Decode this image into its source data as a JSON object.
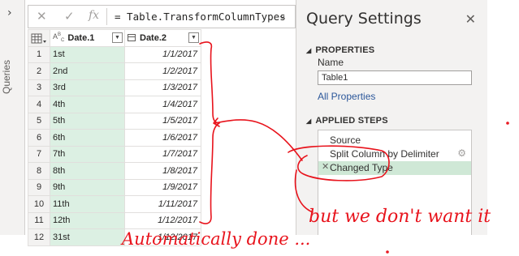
{
  "left_rail": {
    "expand_glyph": "›",
    "label": "Queries"
  },
  "formula_bar": {
    "cancel_glyph": "✕",
    "commit_glyph": "✓",
    "fx_glyph": "fx",
    "formula": "= Table.TransformColumnTypes",
    "dropdown_glyph": "⌄"
  },
  "grid": {
    "columns": [
      {
        "type_badge": "Aᴮc",
        "name": "Date.1",
        "type": "text-icon"
      },
      {
        "type_badge": "",
        "name": "Date.2",
        "type": "calendar-icon"
      }
    ],
    "rows": [
      {
        "n": "1",
        "c1": "1st",
        "c2": "1/1/2017"
      },
      {
        "n": "2",
        "c1": "2nd",
        "c2": "1/2/2017"
      },
      {
        "n": "3",
        "c1": "3rd",
        "c2": "1/3/2017"
      },
      {
        "n": "4",
        "c1": "4th",
        "c2": "1/4/2017"
      },
      {
        "n": "5",
        "c1": "5th",
        "c2": "1/5/2017"
      },
      {
        "n": "6",
        "c1": "6th",
        "c2": "1/6/2017"
      },
      {
        "n": "7",
        "c1": "7th",
        "c2": "1/7/2017"
      },
      {
        "n": "8",
        "c1": "8th",
        "c2": "1/8/2017"
      },
      {
        "n": "9",
        "c1": "9th",
        "c2": "1/9/2017"
      },
      {
        "n": "10",
        "c1": "11th",
        "c2": "1/11/2017"
      },
      {
        "n": "11",
        "c1": "12th",
        "c2": "1/12/2017"
      },
      {
        "n": "12",
        "c1": "31st",
        "c2": "1/12/2017"
      }
    ]
  },
  "query_settings": {
    "title": "Query Settings",
    "close_glyph": "✕",
    "properties_heading": "PROPERTIES",
    "name_label": "Name",
    "name_value": "Table1",
    "all_properties_link": "All Properties",
    "applied_steps_heading": "APPLIED STEPS",
    "steps": [
      {
        "label": "Source",
        "gear": false,
        "selected": false
      },
      {
        "label": "Split Column by Delimiter",
        "gear": true,
        "selected": false
      },
      {
        "label": "Changed Type",
        "gear": false,
        "selected": true
      }
    ]
  },
  "annotations": {
    "ink_color": "#e8131c",
    "bottom_left_text": "Automatically done ...",
    "bottom_right_text": "but we don't want it"
  }
}
